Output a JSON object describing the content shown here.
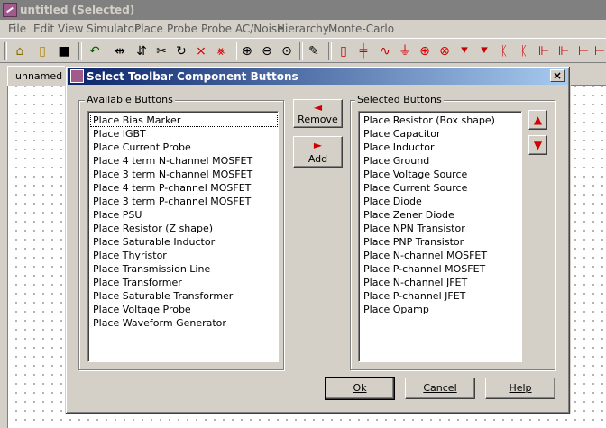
{
  "window": {
    "title": "untitled (Selected)"
  },
  "menu": [
    "File",
    "Edit",
    "View",
    "Simulator",
    "Place",
    "Probe",
    "Probe AC/Noise",
    "Hierarchy",
    "Monte-Carlo"
  ],
  "toolbar": {
    "icons": [
      "open-folder-icon",
      "new-file-icon",
      "save-icon",
      "undo-icon",
      "flip-icon",
      "mirror-icon",
      "cut-icon",
      "redo-icon",
      "delete-icon",
      "delete-all-icon",
      "zoom-fit-icon",
      "zoom-out-icon",
      "zoom-in-icon",
      "pencil-icon",
      "resistor-icon",
      "capacitor-icon",
      "inductor-icon",
      "ground-icon",
      "voltage-source-icon",
      "current-source-icon",
      "diode-icon",
      "zener-icon",
      "npn-icon",
      "pnp-icon",
      "nmos-icon",
      "pmos-icon",
      "njfet-icon",
      "pjfet-icon"
    ],
    "accent": "#cc0000"
  },
  "tab": {
    "label": "unnamed"
  },
  "dialog": {
    "title": "Select Toolbar Component Buttons",
    "close_glyph": "×",
    "available_label": "Available Buttons",
    "selected_label": "Selected Buttons",
    "available": [
      "Place Bias Marker",
      "Place IGBT",
      "Place Current Probe",
      "Place 4 term N-channel MOSFET",
      "Place 3 term N-channel MOSFET",
      "Place 4 term P-channel MOSFET",
      "Place 3 term P-channel MOSFET",
      "Place PSU",
      "Place Resistor (Z shape)",
      "Place Saturable Inductor",
      "Place Thyristor",
      "Place Transmission Line",
      "Place Transformer",
      "Place Saturable Transformer",
      "Place Voltage Probe",
      "Place Waveform Generator"
    ],
    "selected": [
      "Place Resistor (Box shape)",
      "Place Capacitor",
      "Place Inductor",
      "Place Ground",
      "Place Voltage Source",
      "Place Current Source",
      "Place Diode",
      "Place Zener Diode",
      "Place NPN Transistor",
      "Place PNP Transistor",
      "Place N-channel MOSFET",
      "Place P-channel MOSFET",
      "Place N-channel JFET",
      "Place P-channel JFET",
      "Place Opamp"
    ],
    "remove_label": "Remove",
    "add_label": "Add",
    "remove_arrow": "◄",
    "add_arrow": "►",
    "up_arrow": "▲",
    "down_arrow": "▼",
    "ok_label": "Ok",
    "cancel_label": "Cancel",
    "help_label": "Help"
  }
}
